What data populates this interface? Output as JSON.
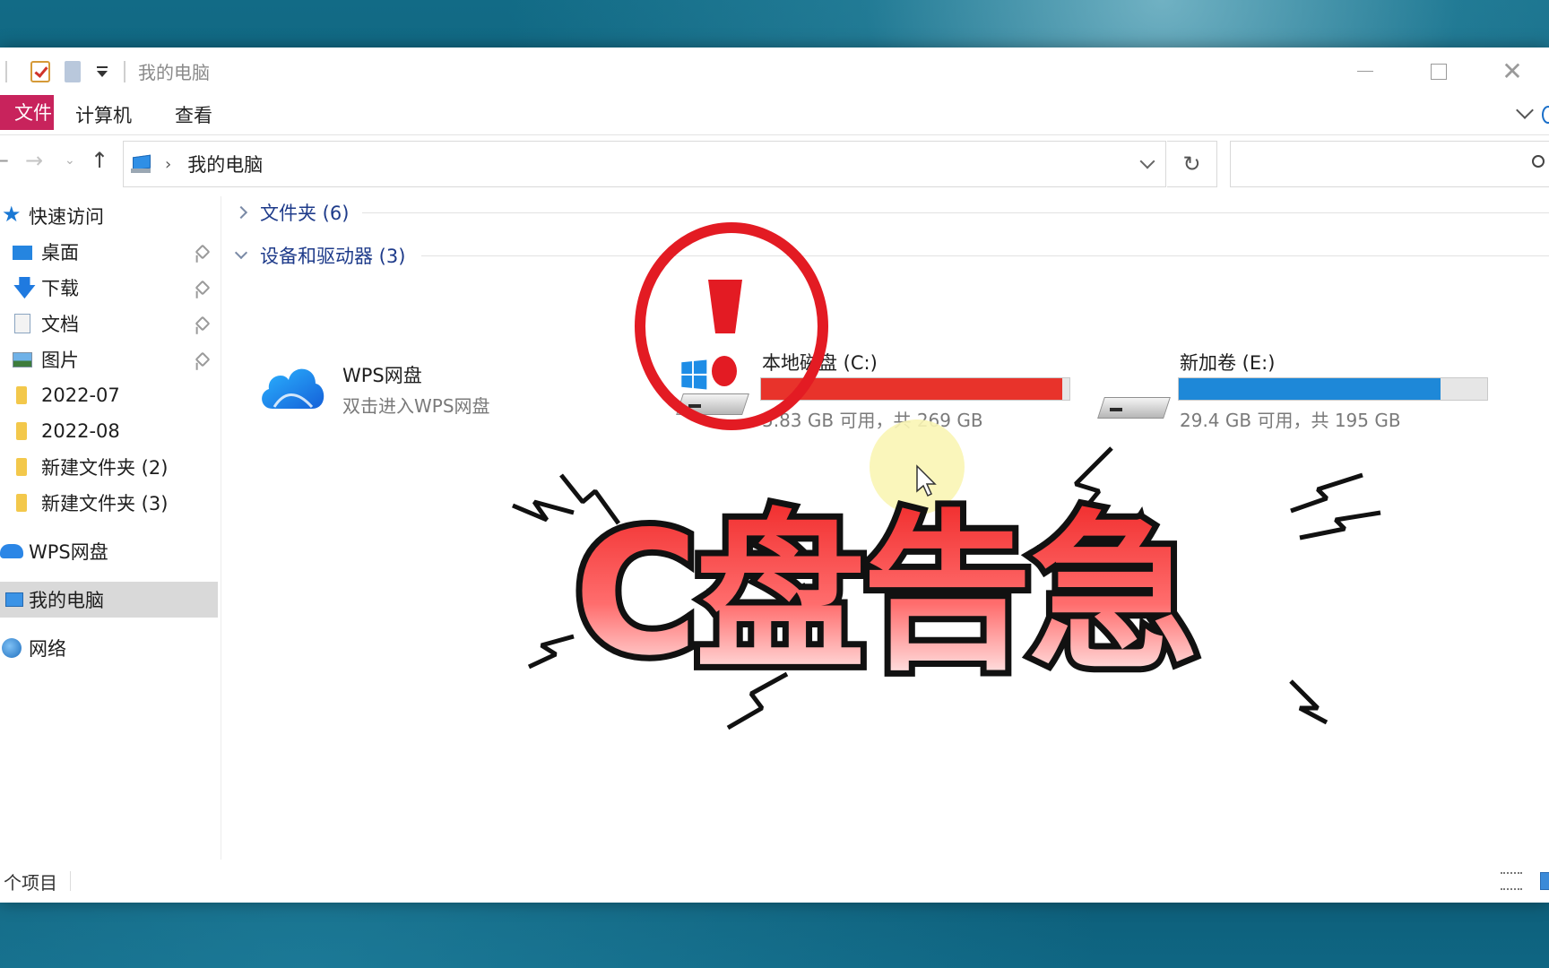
{
  "window": {
    "title": "我的电脑",
    "controls": {
      "minimize": "—",
      "maximize": "☐",
      "close": "✕"
    }
  },
  "ribbon": {
    "file_tab": "文件",
    "tabs": [
      "计算机",
      "查看"
    ]
  },
  "navigation": {
    "back": "←",
    "forward": "→",
    "recent": "⌄",
    "up": "↑",
    "breadcrumb_separator": "›",
    "address_path": "我的电脑",
    "refresh": "↻",
    "search_placeholder": ""
  },
  "sidebar": {
    "quick_access": "快速访问",
    "pinned": [
      {
        "label": "桌面",
        "icon": "desktop-icon"
      },
      {
        "label": "下载",
        "icon": "download-icon"
      },
      {
        "label": "文档",
        "icon": "document-icon"
      },
      {
        "label": "图片",
        "icon": "picture-icon"
      }
    ],
    "folders": [
      "2022-07",
      "2022-08",
      "新建文件夹 (2)",
      "新建文件夹 (3)"
    ],
    "wps_cloud": "WPS网盘",
    "this_pc": "我的电脑",
    "network": "网络"
  },
  "content": {
    "groups": {
      "folders": "文件夹 (6)",
      "devices": "设备和驱动器 (3)"
    },
    "wps_tile": {
      "name": "WPS网盘",
      "subtitle": "双击进入WPS网盘"
    },
    "drives": [
      {
        "name": "本地磁盘 (C:)",
        "free_text": "5.83 GB 可用，共 269 GB",
        "used_fraction": 0.978,
        "bar_color": "#e8332b",
        "icon": "windows-drive-icon"
      },
      {
        "name": "新加卷 (E:)",
        "free_text": "29.4 GB 可用，共 195 GB",
        "used_fraction": 0.849,
        "bar_color": "#1e88d8",
        "icon": "hard-drive-icon"
      }
    ]
  },
  "statusbar": {
    "item_count": "个项目"
  },
  "overlay": {
    "headline": "C盘告急",
    "exclamation": "!",
    "highlight_color": "#e31b23"
  }
}
